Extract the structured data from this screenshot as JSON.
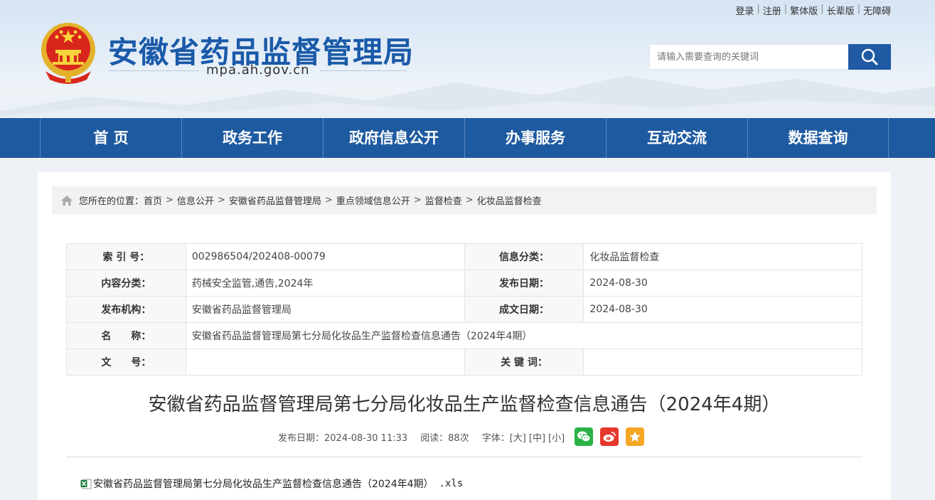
{
  "toplinks": [
    "登录",
    "注册",
    "繁体版",
    "长辈版",
    "无障碍"
  ],
  "site": {
    "title": "安徽省药品监督管理局",
    "domain": "mpa.ah.gov.cn"
  },
  "search": {
    "placeholder": "请输入需要查询的关键词"
  },
  "nav": [
    "首 页",
    "政务工作",
    "政府信息公开",
    "办事服务",
    "互动交流",
    "数据查询"
  ],
  "breadcrumb": {
    "prefix": "您所在的位置：",
    "items": [
      "首页",
      "信息公开",
      "安徽省药品监督管理局",
      "重点领域信息公开",
      "监督检查",
      "化妆品监督检查"
    ]
  },
  "meta": {
    "index_label": "索 引 号：",
    "index_value": "002986504/202408-00079",
    "category_label": "信息分类：",
    "category_value": "化妆品监督检查",
    "content_label": "内容分类：",
    "content_value": "药械安全监管,通告,2024年",
    "pubdate_label": "发布日期：",
    "pubdate_value": "2024-08-30",
    "org_label": "发布机构：",
    "org_value": "安徽省药品监督管理局",
    "date_label": "成文日期：",
    "date_value": "2024-08-30",
    "name_label": "名　　称：",
    "name_value": "安徽省药品监督管理局第七分局化妆品生产监督检查信息通告（2024年4期）",
    "docno_label": "文　　号：",
    "docno_value": "",
    "keyword_label": "关 键 词：",
    "keyword_value": ""
  },
  "article": {
    "title": "安徽省药品监督管理局第七分局化妆品生产监督检查信息通告（2024年4期）",
    "published": "发布日期：2024-08-30 11:33",
    "views": "阅读：88次",
    "font_label": "字体：",
    "font_large": "[大]",
    "font_medium": "[中]",
    "font_small": "[小]",
    "attachment_name": "安徽省药品监督管理局第七分局化妆品生产监督检查信息通告（2024年4期）",
    "attachment_ext": ".xls"
  },
  "colors": {
    "brand": "#1e5aa0",
    "title": "#1a5aa8",
    "wechat": "#2ab246",
    "weibo": "#e6372c",
    "favorite": "#f5a623"
  },
  "icons": [
    "emblem-icon",
    "search-icon",
    "home-icon",
    "wechat-icon",
    "weibo-icon",
    "favorite-icon",
    "excel-file-icon"
  ]
}
